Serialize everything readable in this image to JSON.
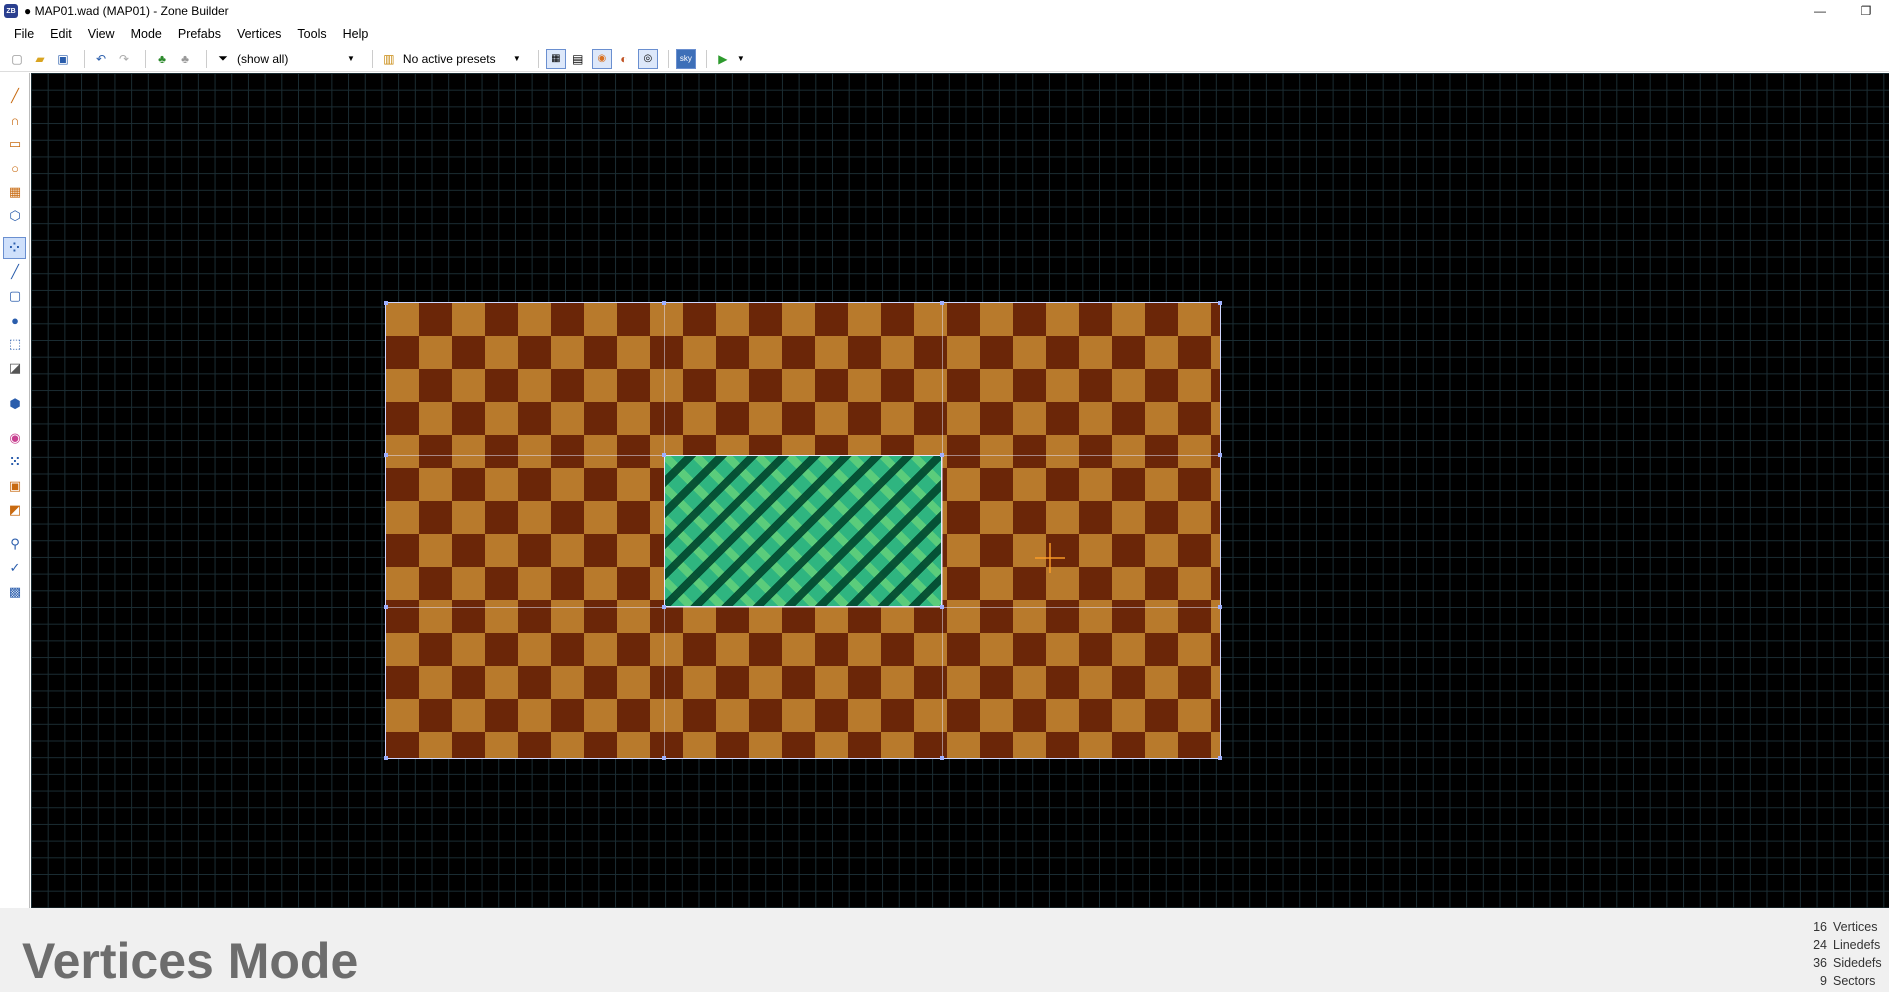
{
  "window": {
    "title": "● MAP01.wad (MAP01) - Zone Builder",
    "app_icon_text": "ZB",
    "minimize_symbol": "—",
    "restore_symbol": "❐"
  },
  "menu": [
    "File",
    "Edit",
    "View",
    "Mode",
    "Prefabs",
    "Vertices",
    "Tools",
    "Help"
  ],
  "toolbar": {
    "filter_value": "(show all)",
    "presets_value": "No active presets",
    "sky_label": "sky"
  },
  "mode": {
    "label": "Vertices Mode"
  },
  "stats": [
    {
      "count": "16",
      "label": "Vertices"
    },
    {
      "count": "24",
      "label": "Linedefs"
    },
    {
      "count": "36",
      "label": "Sidedefs"
    },
    {
      "count": "9",
      "label": "Sectors"
    }
  ],
  "colors": {
    "canvas_bg": "#000000",
    "grid": "#1b2d33",
    "floor_brown_dark": "#6b2608",
    "floor_brown_light": "#b87a2c",
    "floor_green": "#2fb580",
    "linedef": "#cfd6ff",
    "mode_text": "#6d6d6d"
  }
}
